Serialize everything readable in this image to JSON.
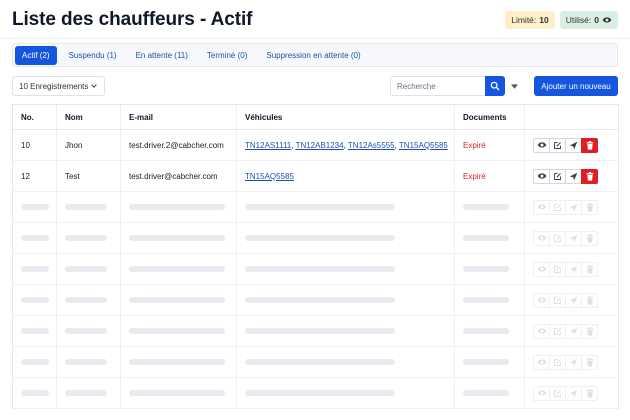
{
  "header": {
    "title": "Liste des chauffeurs - Actif",
    "limit_label": "Limité:",
    "limit_value": "10",
    "used_label": "Utilisé:",
    "used_value": "0",
    "used_icon": "eye-icon"
  },
  "tabs": [
    {
      "label": "Actif (2)",
      "active": true
    },
    {
      "label": "Suspendu (1)",
      "active": false
    },
    {
      "label": "En attente (11)",
      "active": false
    },
    {
      "label": "Terminé (0)",
      "active": false
    },
    {
      "label": "Suppression en attente (0)",
      "active": false
    }
  ],
  "controls": {
    "records_select": "10 Enregistrements",
    "search_placeholder": "Recherche",
    "add_button": "Ajouter un nouveau"
  },
  "table": {
    "headers": [
      "No.",
      "Nom",
      "E-mail",
      "Véhicules",
      "Documents"
    ],
    "rows": [
      {
        "no": "10",
        "name": "Jhon",
        "email": "test.driver.2@cabcher.com",
        "vehicles": [
          "TN12AS1111",
          "TN12AB1234",
          "TN12As5555",
          "TN15AQ5585"
        ],
        "documents": "Expiré"
      },
      {
        "no": "12",
        "name": "Test",
        "email": "test.driver@cabcher.com",
        "vehicles": [
          "TN15AQ5585"
        ],
        "documents": "Expiré"
      }
    ],
    "placeholder_rows": 7,
    "actions": [
      "eye-icon",
      "edit-icon",
      "send-icon",
      "trash-icon"
    ]
  },
  "colors": {
    "primary": "#1456e0",
    "danger": "#e11d24",
    "expired_text": "#dc2626",
    "limit_badge_bg": "#fdf0c8",
    "used_badge_bg": "#d9efe3"
  }
}
